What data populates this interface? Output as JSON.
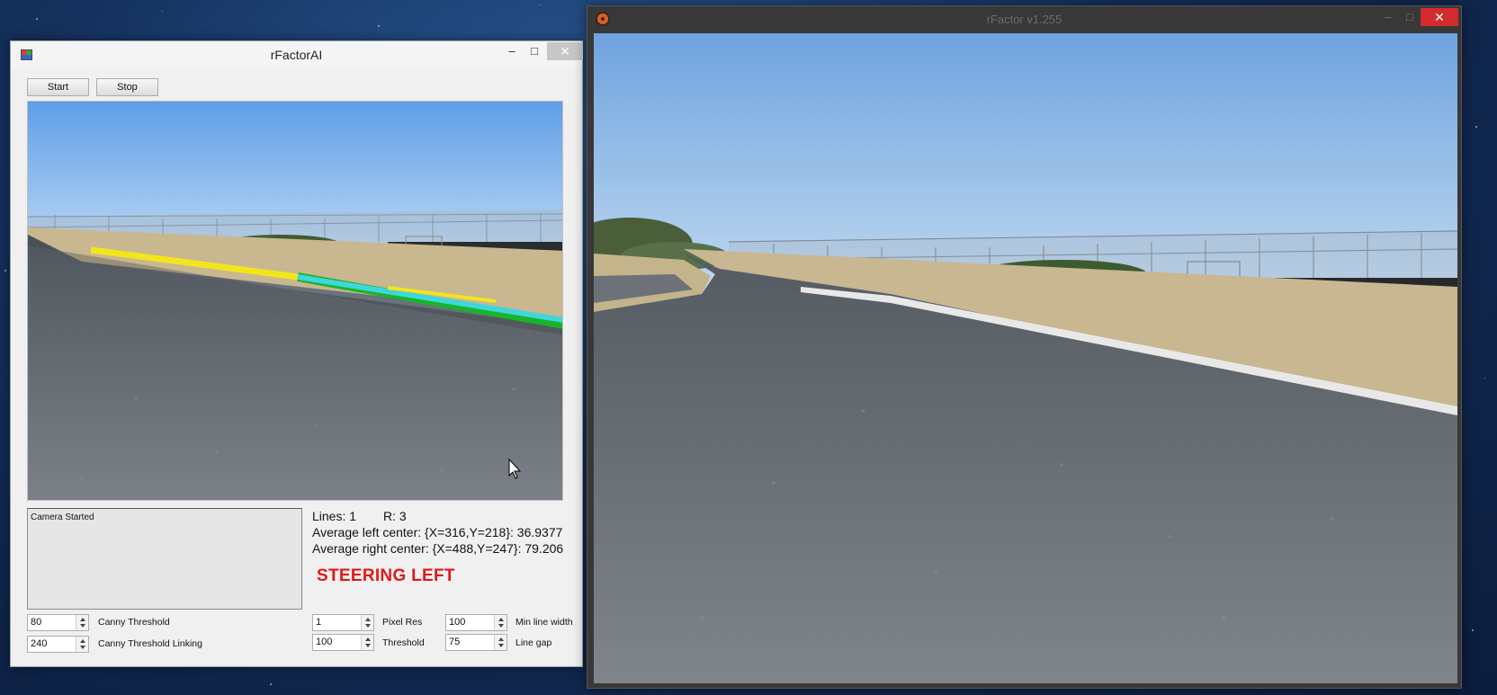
{
  "desktop": {
    "background": "#14305c"
  },
  "rfactor_ai": {
    "title": "rFactorAI",
    "controls": {
      "minimize": "–",
      "maximize": "□",
      "close": "✕"
    },
    "buttons": {
      "start": "Start",
      "stop": "Stop"
    },
    "log": {
      "text": "Camera Started"
    },
    "stats": {
      "lines": "Lines: 1",
      "r": "R: 3",
      "avg_left": "Average left center: {X=316,Y=218}: 36.9377",
      "avg_right": "Average right center: {X=488,Y=247}: 79.206"
    },
    "steering": {
      "text": "STEERING LEFT",
      "color": "#e11818"
    },
    "params": {
      "canny_threshold": {
        "value": "80",
        "label": "Canny Threshold"
      },
      "canny_threshold_linking": {
        "value": "240",
        "label": "Canny Threshold Linking"
      },
      "pixel_res": {
        "value": "1",
        "label": "Pixel Res"
      },
      "threshold": {
        "value": "100",
        "label": "Threshold"
      },
      "min_line_width": {
        "value": "100",
        "label": "Min line width"
      },
      "line_gap": {
        "value": "75",
        "label": "Line gap"
      }
    },
    "detected_lines": {
      "left_color": "#f2e51c",
      "right_color": "#3fd6dc",
      "edge_color": "#17b52a"
    }
  },
  "rfactor_game": {
    "title": "rFactor v1.255",
    "controls": {
      "minimize": "–",
      "maximize": "□",
      "close": "✕"
    },
    "close_color": "#d32c2c"
  }
}
